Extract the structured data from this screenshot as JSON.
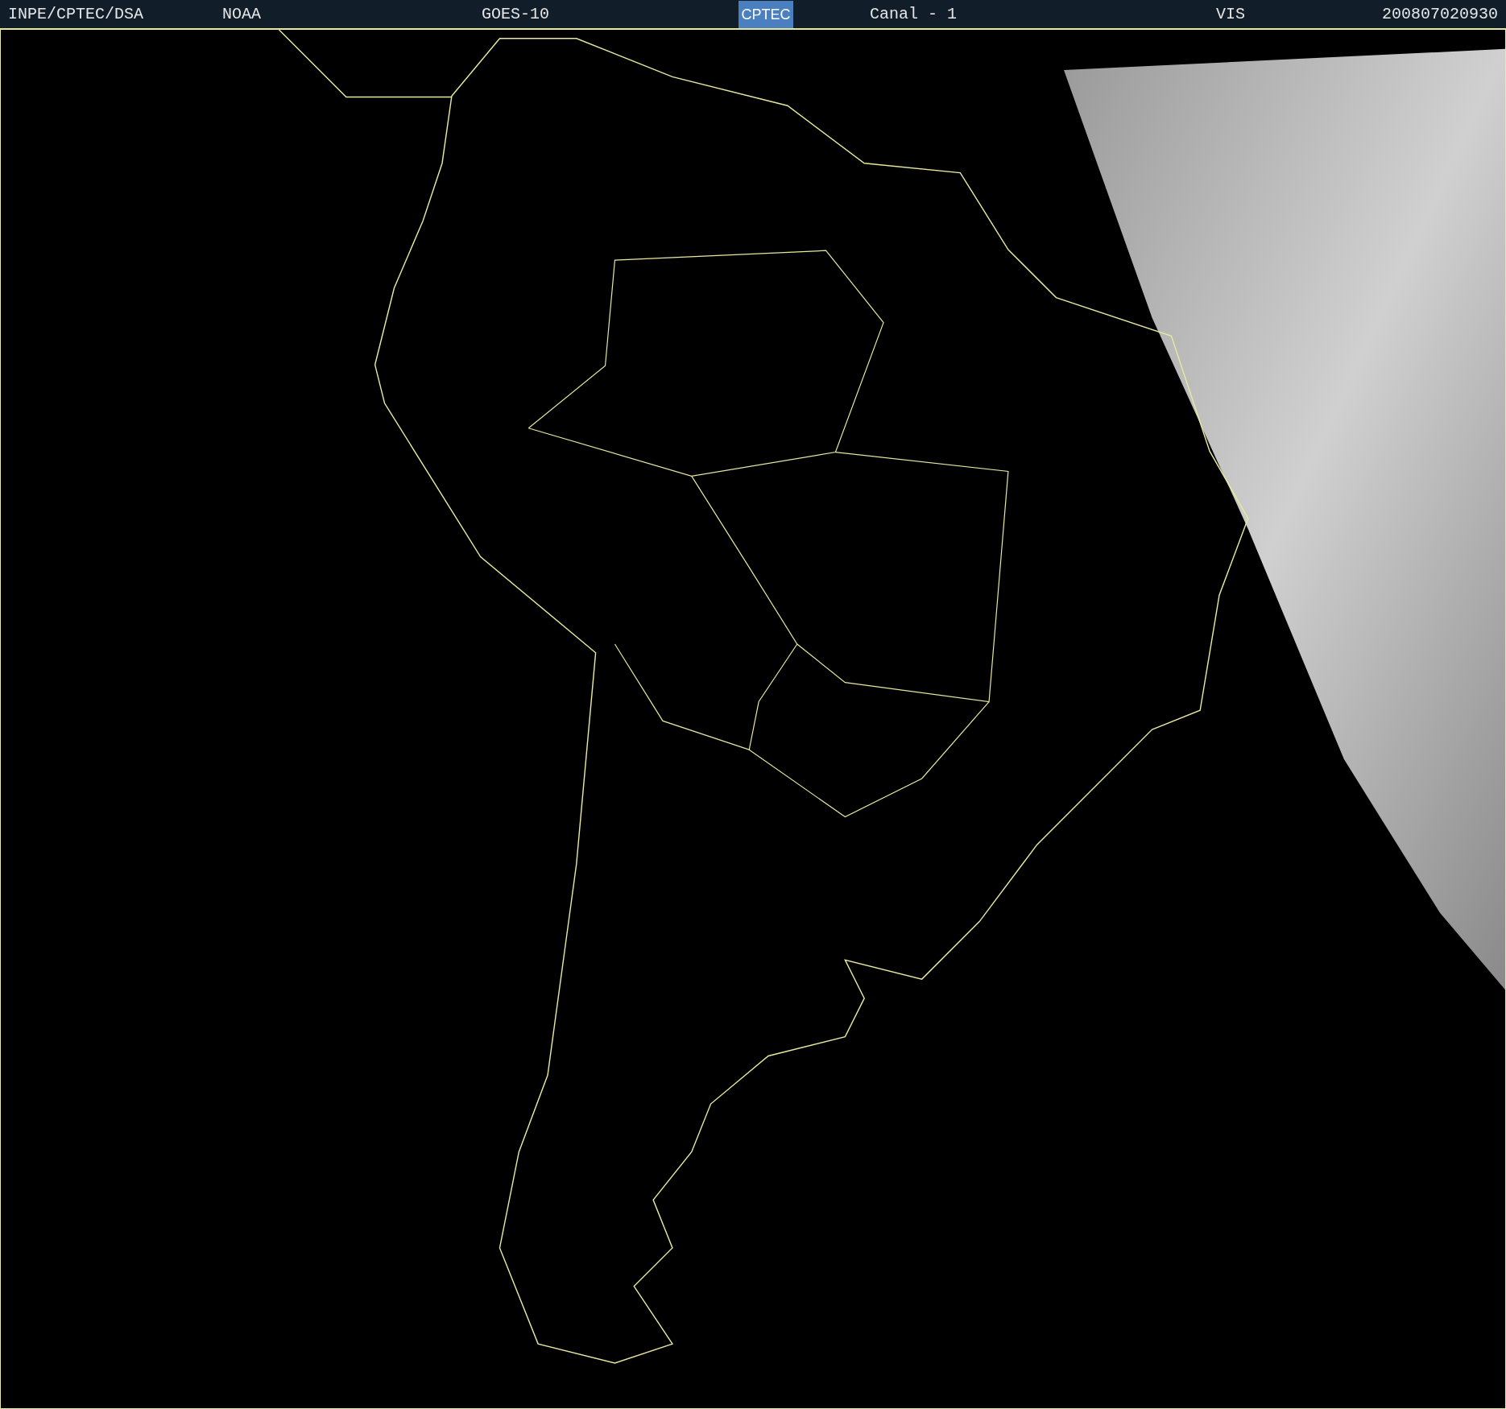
{
  "header": {
    "agency": "INPE/CPTEC/DSA",
    "source": "NOAA",
    "satellite": "GOES-10",
    "logo_text": "CPTEC",
    "channel": "Canal - 1",
    "band": "VIS",
    "timestamp": "200807020930"
  }
}
